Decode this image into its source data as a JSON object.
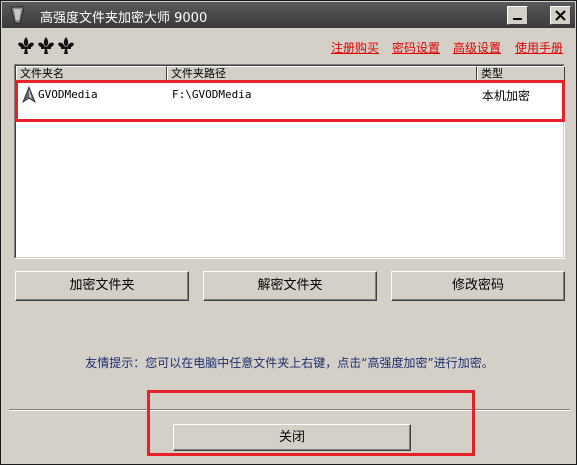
{
  "window": {
    "title": "高强度文件夹加密大师 9000"
  },
  "menu": [
    {
      "label": "注册购买"
    },
    {
      "label": "密码设置"
    },
    {
      "label": "高级设置"
    },
    {
      "label": "使用手册"
    }
  ],
  "table": {
    "columns": [
      "文件夹名",
      "文件夹路径",
      "类型"
    ],
    "rows": [
      {
        "name": "GVODMedia",
        "path": "F:\\GVODMedia",
        "type": "本机加密",
        "icon": "folder-lock-icon"
      }
    ]
  },
  "buttons": {
    "encrypt": "加密文件夹",
    "decrypt": "解密文件夹",
    "change_password": "修改密码",
    "close": "关闭"
  },
  "tip": "友情提示：您可以在电脑中任意文件夹上右键，点击“高强度加密”进行加密。",
  "colors": {
    "highlight_box": "#e8202a",
    "menu_link": "#e00000",
    "tip_text": "#1c2e6e",
    "titlebar": "#3a3a3a"
  }
}
